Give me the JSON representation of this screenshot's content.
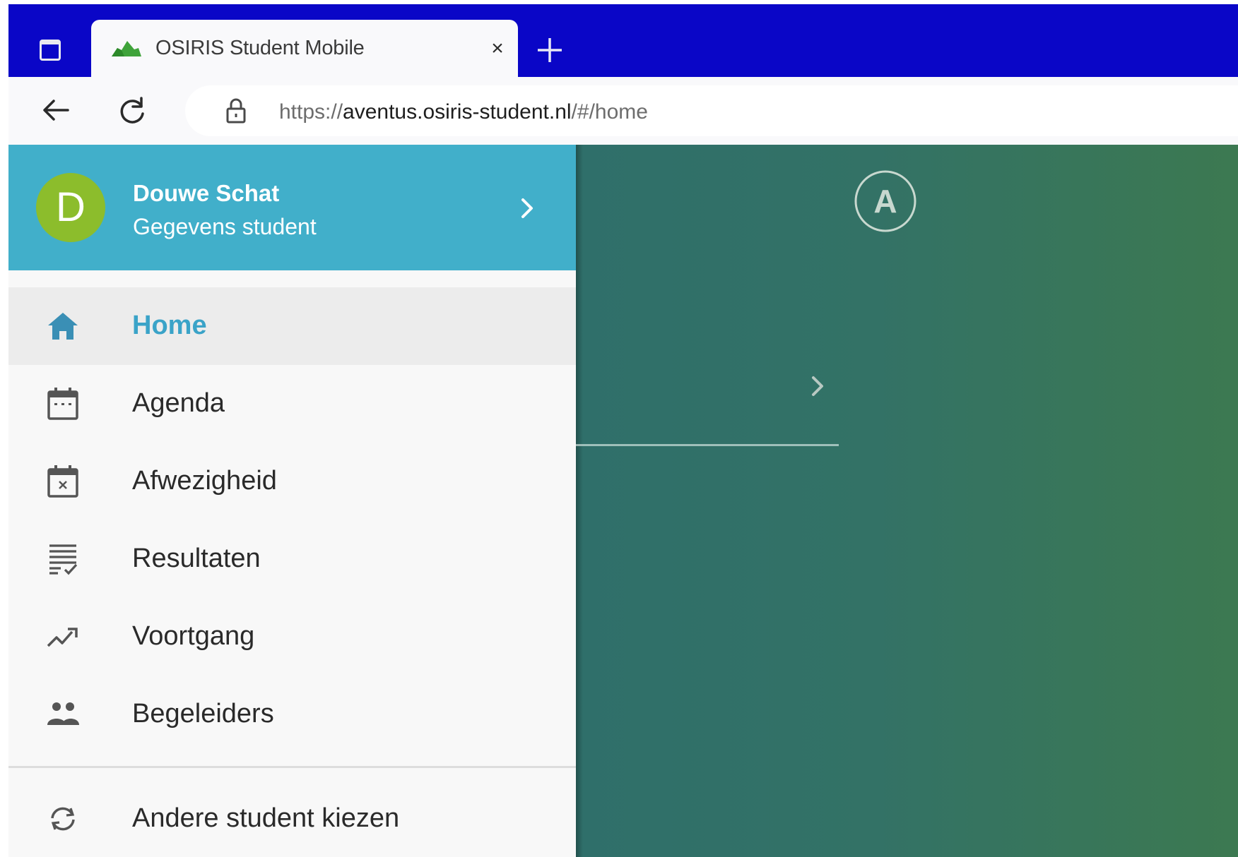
{
  "browser": {
    "tab_title": "OSIRIS Student Mobile",
    "tab_close_glyph": "×",
    "url_prefix": "https://",
    "url_host": "aventus.osiris-student.nl",
    "url_path": "/#/home",
    "icons": [
      "window-icon",
      "favicon-icon",
      "close-icon",
      "plus-icon",
      "back-arrow-icon",
      "reload-icon",
      "lock-icon"
    ],
    "colors": {
      "tabstrip": "#0a06c7",
      "toolbar": "#f9f9fb"
    }
  },
  "profile": {
    "initial": "D",
    "name": "Douwe Schat",
    "subtitle": "Gegevens student",
    "avatar_color": "#8cbd2c",
    "header_color": "#41afca"
  },
  "nav": {
    "items": [
      {
        "label": "Home",
        "icon": "home-icon",
        "active": true
      },
      {
        "label": "Agenda",
        "icon": "calendar-icon",
        "active": false
      },
      {
        "label": "Afwezigheid",
        "icon": "calendar-cancel-icon",
        "active": false
      },
      {
        "label": "Resultaten",
        "icon": "list-check-icon",
        "active": false
      },
      {
        "label": "Voortgang",
        "icon": "trending-up-icon",
        "active": false
      },
      {
        "label": "Begeleiders",
        "icon": "people-icon",
        "active": false
      }
    ],
    "switch_student": {
      "label": "Andere student kiezen",
      "icon": "switch-icon"
    },
    "active_color": "#3aa3c8"
  },
  "content": {
    "logo_letter": "A",
    "background_from": "#2f6f6a",
    "background_to": "#3c7951"
  }
}
